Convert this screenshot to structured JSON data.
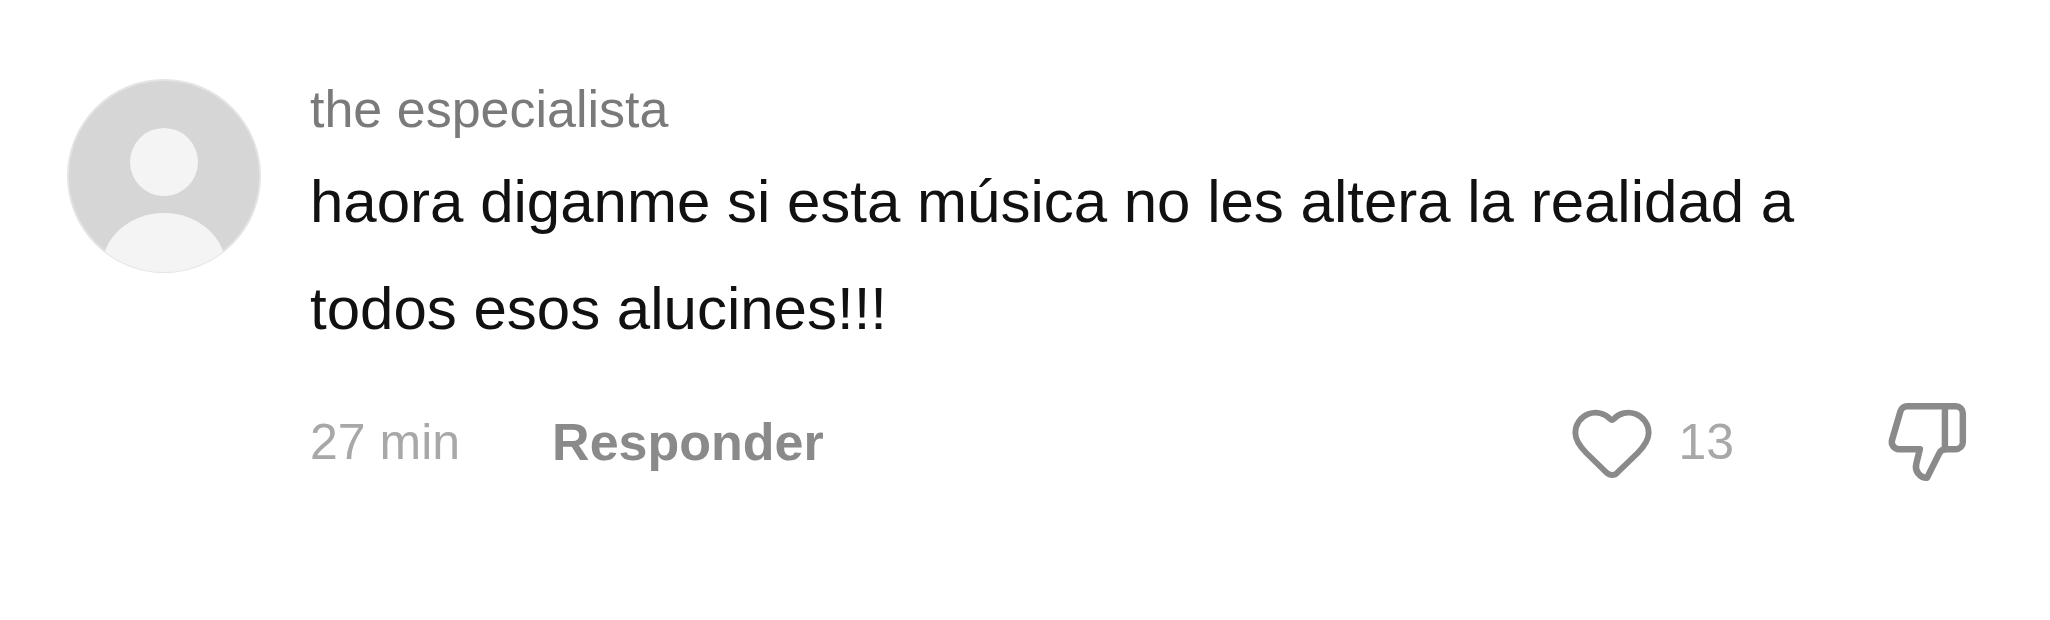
{
  "comment": {
    "username": "the especialista",
    "text": "haora diganme si esta música no les altera la realidad a todos esos alucines!!!",
    "time": "27 min",
    "reply_label": "Responder",
    "likes": "13",
    "liked": false,
    "disliked": false
  }
}
